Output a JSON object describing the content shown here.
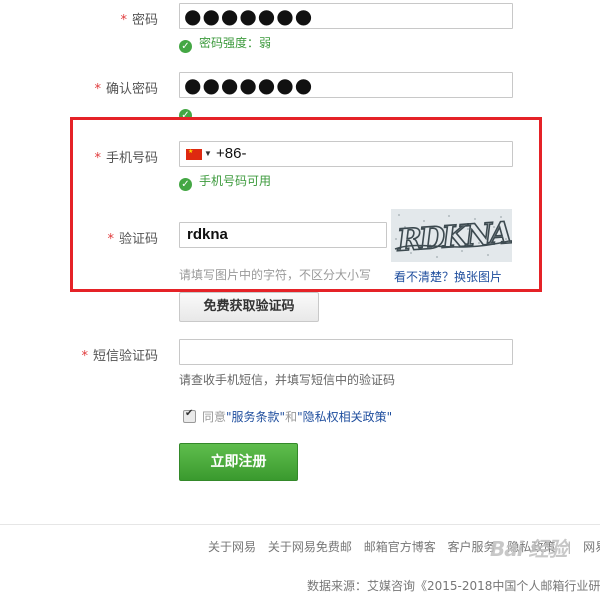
{
  "password": {
    "label": "密码",
    "masked_value": "●●●●●●●",
    "strength_text": "密码强度：弱"
  },
  "confirm_password": {
    "label": "确认密码",
    "masked_value": "●●●●●●●"
  },
  "phone": {
    "label": "手机号码",
    "country": "China",
    "value": "+86-",
    "valid_text": "手机号码可用"
  },
  "captcha": {
    "label": "验证码",
    "value": "rdkna",
    "hint": "请填写图片中的字符，不区分大小写",
    "refresh_link": "看不清楚？换张图片",
    "image_text": "RDKNA"
  },
  "sms_button": {
    "label": "免费获取验证码"
  },
  "sms_code": {
    "label": "短信验证码",
    "value": "",
    "hint": "请查收手机短信，并填写短信中的验证码"
  },
  "agreement": {
    "checked": true,
    "prefix": "同意",
    "link1": "\"服务条款\"",
    "middle": "和",
    "link2": "\"隐私权相关政策\""
  },
  "register_button": {
    "label": "立即注册"
  },
  "required_mark": "*",
  "footer": {
    "links": [
      "关于网易",
      "关于网易免费邮",
      "邮箱官方博客",
      "客户服务",
      "隐私政策"
    ],
    "separator": "|",
    "trailing_link": "网易公",
    "source": "数据来源：艾媒咨询《2015-2018中国个人邮箱行业研"
  },
  "watermark": "Bai 经验",
  "colors": {
    "highlight_box": "#e52227",
    "success_green": "#44a744",
    "primary_button": "#4aab3b",
    "link_blue": "#1f4e9e",
    "required": "#e0393b"
  }
}
